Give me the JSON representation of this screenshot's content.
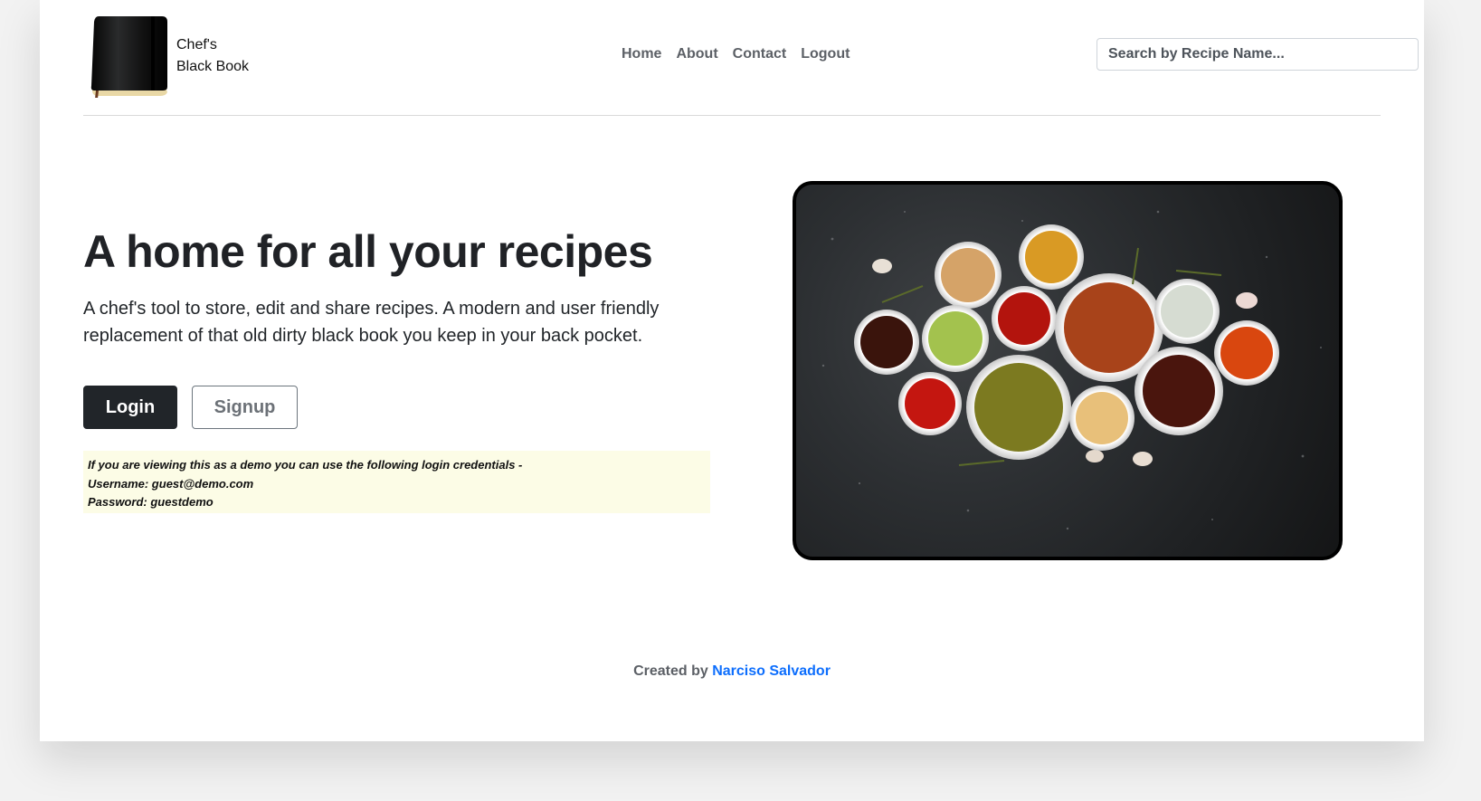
{
  "brand": {
    "line1": "Chef's",
    "line2": "Black Book",
    "icon": "notebook-icon"
  },
  "nav": {
    "items": [
      {
        "label": "Home"
      },
      {
        "label": "About"
      },
      {
        "label": "Contact"
      },
      {
        "label": "Logout"
      }
    ]
  },
  "search": {
    "placeholder": "Search by Recipe Name...",
    "value": ""
  },
  "hero": {
    "title": "A home for all your recipes",
    "lead": "A chef's tool to store, edit and share recipes. A modern and user friendly replacement of that old dirty black book you keep in your back pocket.",
    "login_label": "Login",
    "signup_label": "Signup",
    "demo_note": {
      "line1": "If you are viewing this as a demo you can use the following login credentials -",
      "line2": "Username: guest@demo.com",
      "line3": "Password: guestdemo"
    },
    "image_icon": "sauce-bowls-photo"
  },
  "footer": {
    "prefix": "Created by",
    "author": "Narciso Salvador"
  },
  "colors": {
    "primary_dark": "#212529",
    "link_blue": "#0d6efd",
    "note_bg": "#fcfce6",
    "nav_text": "#5c6066"
  }
}
